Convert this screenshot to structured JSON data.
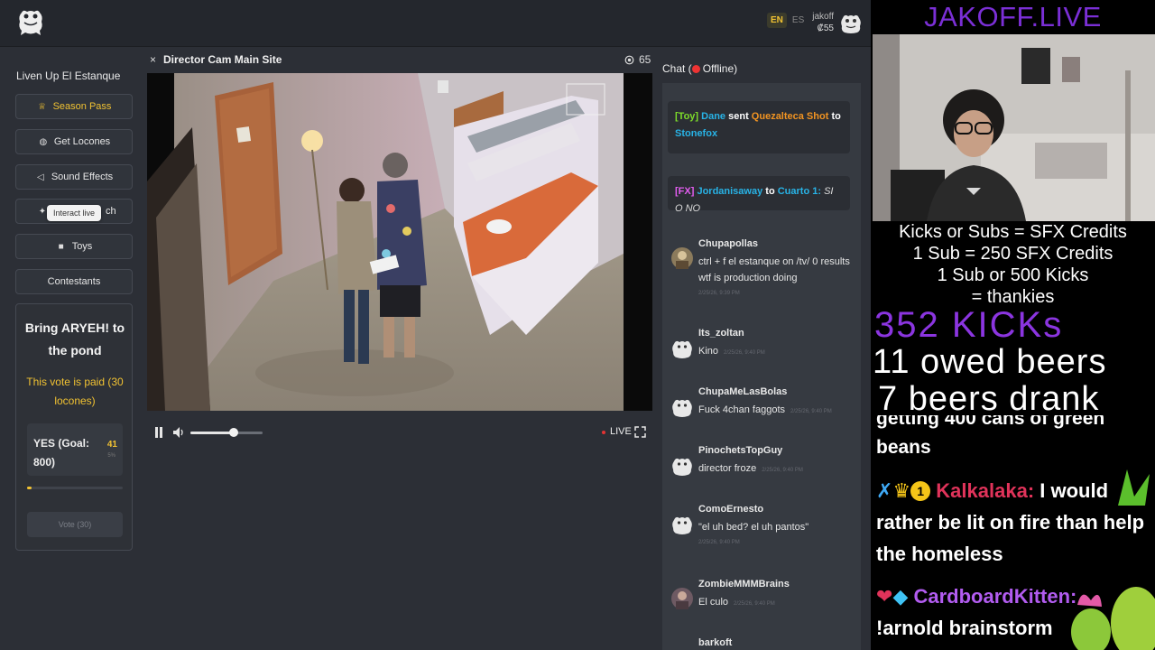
{
  "header": {
    "languages": {
      "active": "EN",
      "other": "ES"
    },
    "user": {
      "name": "jakoff",
      "balance": "₡55"
    }
  },
  "sidebar": {
    "title": "Liven Up El Estanque",
    "buttons": [
      {
        "label": "Season Pass",
        "icon": "crown-icon"
      },
      {
        "label": "Get Locones",
        "icon": "coin-icon"
      },
      {
        "label": "Sound Effects",
        "icon": "speaker-icon"
      },
      {
        "label": "ch",
        "icon": "wand-icon"
      },
      {
        "label": "Toys",
        "icon": "gift-icon"
      },
      {
        "label": "Contestants",
        "icon": ""
      }
    ],
    "tooltip": "Interact live",
    "vote": {
      "title": "Bring ARYEH! to the pond",
      "paid_note": "This vote is paid (30 locones)",
      "option_label": "YES (Goal: 800)",
      "option_count": "41",
      "option_percent": "5%",
      "progress_fraction": 0.051,
      "button_label": "Vote (30)"
    }
  },
  "video": {
    "close_label": "×",
    "title": "Director Cam Main Site",
    "viewers": "65",
    "live_label": "LIVE",
    "volume_fraction": 0.6
  },
  "chat": {
    "header_prefix": "Chat (",
    "status": "Offline)",
    "events": [
      {
        "tag": "[Toy]",
        "user": "Dane",
        "verb": "sent",
        "item": "Quezalteca Shot",
        "prep": "to",
        "target": "Stonefox"
      },
      {
        "tag": "[FX]",
        "user": "Jordanisaway",
        "prep": "to",
        "target": "Cuarto 1:",
        "message": "SI O NO"
      }
    ],
    "messages": [
      {
        "user": "Chupapollas",
        "text": "ctrl + f el estanque on /tv/ 0 results wtf is production doing",
        "time": "2/25/26, 9:39 PM"
      },
      {
        "user": "Its_zoltan",
        "text": "Kino",
        "time": "2/25/26, 9:40 PM"
      },
      {
        "user": "ChupaMeLasBolas",
        "text": "Fuck 4chan faggots",
        "time": "2/25/26, 9:40 PM"
      },
      {
        "user": "PinochetsTopGuy",
        "text": "director froze",
        "time": "2/25/26, 9:40 PM"
      },
      {
        "user": "ComoErnesto",
        "text": "\"el uh bed? el uh pantos\"",
        "time": "2/25/26, 9:40 PM"
      },
      {
        "user": "ZombieMMMBrains",
        "text": "El culo",
        "time": "2/25/26, 9:40 PM"
      },
      {
        "user": "barkoft",
        "text": "",
        "time": ""
      }
    ]
  },
  "overlay": {
    "title": "JAKOFF.LIVE",
    "lines": [
      "Kicks or Subs = SFX Credits",
      "1 Sub = 250 SFX Credits",
      "1 Sub or 500 Kicks",
      "= thankies"
    ],
    "kicks": "352 KICKs",
    "owed": "11 owed beers",
    "drank": "7 beers drank",
    "chat": [
      {
        "user": "",
        "text": "getting 400 cans of green beans"
      },
      {
        "user": "Kalkalaka:",
        "text": "I would rather be lit on fire than help the homeless"
      },
      {
        "user": "CardboardKitten:",
        "text": "!arnold brainstorm"
      }
    ]
  },
  "colors": {
    "accent": "#f1c232",
    "purple": "#7b2fd6",
    "live_red": "#e33333"
  }
}
